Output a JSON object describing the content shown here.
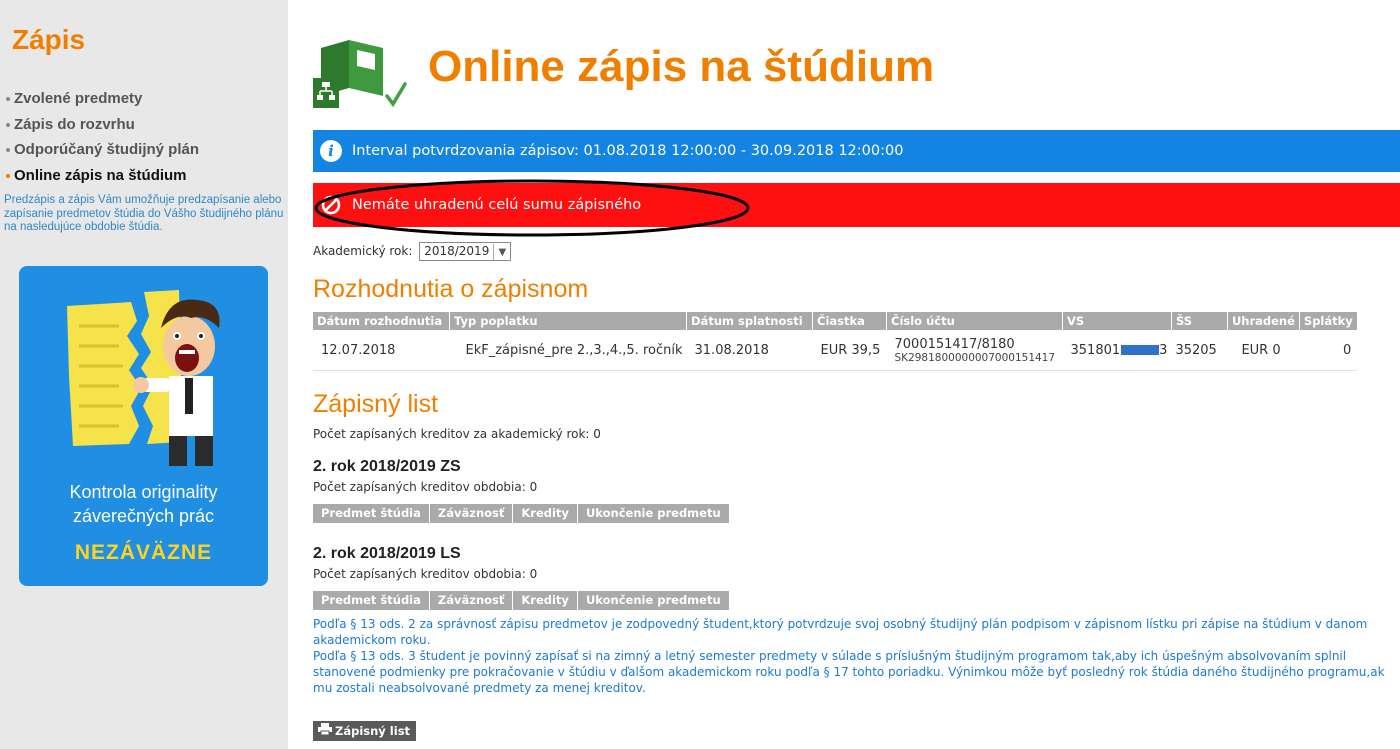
{
  "sidebar": {
    "title": "Zápis",
    "nav": [
      {
        "label": "Zvolené predmety",
        "active": false
      },
      {
        "label": "Zápis do rozvrhu",
        "active": false
      },
      {
        "label": "Odporúčaný študijný plán",
        "active": false
      },
      {
        "label": "Online zápis na štúdium",
        "active": true
      }
    ],
    "description": "Predzápis a zápis Vám umožňuje predzapísanie alebo zapísanie predmetov štúdia do Vášho študijného plánu na nasledujúce obdobie štúdia.",
    "promo": {
      "line1": "Kontrola originality",
      "line2": "záverečných prác",
      "cta": "NEZÁVÄZNE"
    }
  },
  "header": {
    "title": "Online zápis na štúdium"
  },
  "info_message": "Interval potvrdzovania zápisov: 01.08.2018 12:00:00 - 30.09.2018 12:00:00",
  "alert_message": "Nemáte uhradenú celú sumu zápisného",
  "academic_year": {
    "label": "Akademický rok:",
    "selected": "2018/2019"
  },
  "decisions": {
    "title": "Rozhodnutia o zápisnom",
    "columns": [
      "Dátum rozhodnutia",
      "Typ poplatku",
      "Dátum splatnosti",
      "Čiastka",
      "Číslo účtu",
      "VS",
      "ŠS",
      "Uhradené",
      "Splátky"
    ],
    "row": {
      "date": "12.07.2018",
      "fee_type": "EkF_zápisné_pre 2.,3.,4.,5. ročník",
      "due_date": "31.08.2018",
      "amount": "EUR 39,5",
      "account": "7000151417/8180",
      "iban": "SK2981800000007000151417",
      "vs_prefix": "351801",
      "vs_suffix": "3",
      "ss": "35205",
      "paid": "EUR 0",
      "installments": "0"
    }
  },
  "enrollment": {
    "title": "Zápisný list",
    "credits_year": "Počet zapísaných kreditov za akademický rok: 0",
    "semesters": [
      {
        "heading": "2. rok 2018/2019 ZS",
        "credits": "Počet zapísaných kreditov obdobia: 0",
        "columns": [
          "Predmet štúdia",
          "Záväznosť",
          "Kredity",
          "Ukončenie predmetu"
        ]
      },
      {
        "heading": "2. rok 2018/2019 LS",
        "credits": "Počet zapísaných kreditov obdobia: 0",
        "columns": [
          "Predmet štúdia",
          "Záväznosť",
          "Kredity",
          "Ukončenie predmetu"
        ]
      }
    ]
  },
  "notes": [
    "Podľa § 13 ods. 2 za správnosť zápisu predmetov je zodpovedný študent,ktorý potvrdzuje svoj osobný študijný plán podpisom v zápisnom lístku pri zápise na štúdium v danom akademickom roku.",
    "Podľa § 13 ods. 3 študent je povinný zapísať si na zimný a letný semester predmety v súlade s príslušným študijným programom tak,aby ich úspešným absolvovaním splnil stanovené podmienky pre pokračovanie v štúdiu v ďalšom akademickom roku podľa § 17 tohto poriadku. Výnimkou môže byť posledný rok štúdia daného študijného programu,ak mu zostali neabsolvované predmety za menej kreditov."
  ],
  "print_button": "Zápisný list",
  "colors": {
    "accent_orange": "#f07f00",
    "info_blue": "#1484e2",
    "alert_red": "#ff1010",
    "promo_blue": "#1f8ee3",
    "promo_yellow": "#ffd21f",
    "link_blue": "#1d7ad1"
  }
}
